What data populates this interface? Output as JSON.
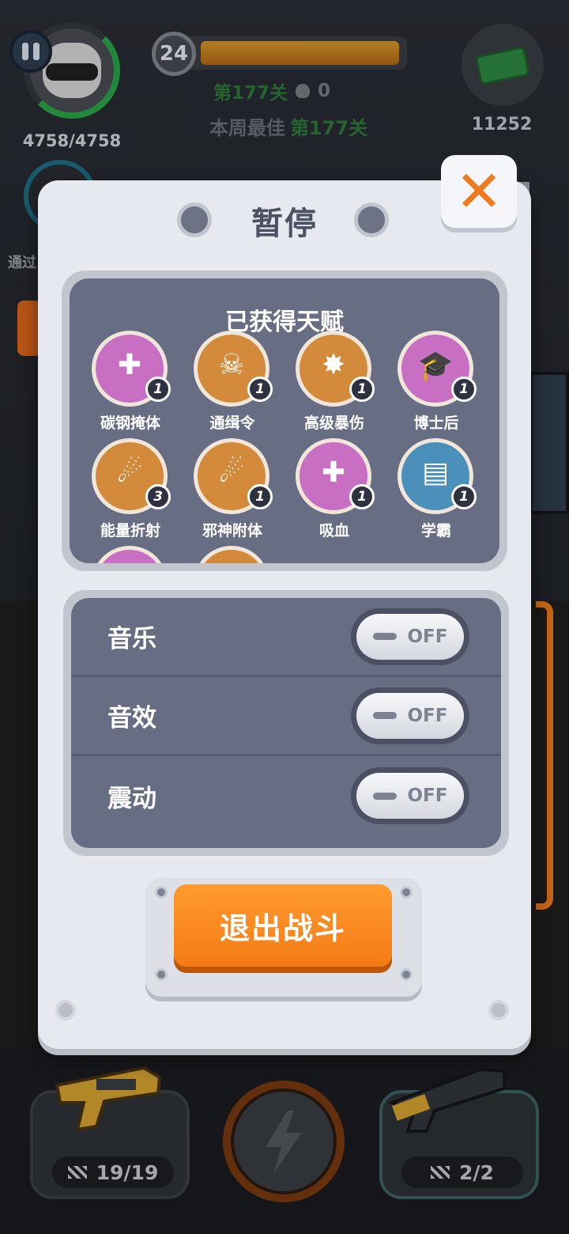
{
  "hud": {
    "hp_text": "4758/4758",
    "level": "24",
    "xp_fraction": 1.0,
    "stage_text": "第177关",
    "deaths": "0",
    "best_label": "本周最佳",
    "best_stage": "第177关",
    "cash": "11252",
    "side_text": "通过"
  },
  "dialog": {
    "title": "暂停",
    "talents_title": "已获得天赋",
    "talents": [
      {
        "name": "碳钢掩体",
        "count": "1",
        "color": "purple",
        "glyph": "✚"
      },
      {
        "name": "通缉令",
        "count": "1",
        "color": "orange",
        "glyph": "☠"
      },
      {
        "name": "高级暴伤",
        "count": "1",
        "color": "orange",
        "glyph": "✸"
      },
      {
        "name": "博士后",
        "count": "1",
        "color": "purple",
        "glyph": "🎓"
      },
      {
        "name": "能量折射",
        "count": "3",
        "color": "orange",
        "glyph": "☄"
      },
      {
        "name": "邪神附体",
        "count": "1",
        "color": "orange",
        "glyph": "☄"
      },
      {
        "name": "吸血",
        "count": "1",
        "color": "purple",
        "glyph": "✚"
      },
      {
        "name": "学霸",
        "count": "1",
        "color": "blue",
        "glyph": "▤"
      }
    ],
    "settings": [
      {
        "label": "音乐",
        "state": "OFF"
      },
      {
        "label": "音效",
        "state": "OFF"
      },
      {
        "label": "震动",
        "state": "OFF"
      }
    ],
    "exit_label": "退出战斗"
  },
  "weapons": {
    "left_ammo": "19/19",
    "right_ammo": "2/2"
  },
  "icons": {
    "close": "close-icon",
    "pause": "pause-icon",
    "skill": "lightning-icon",
    "cash": "cash-icon"
  },
  "colors": {
    "accent_orange": "#f47b15",
    "panel": "#676e84",
    "stage_green": "#2e7a3a"
  }
}
